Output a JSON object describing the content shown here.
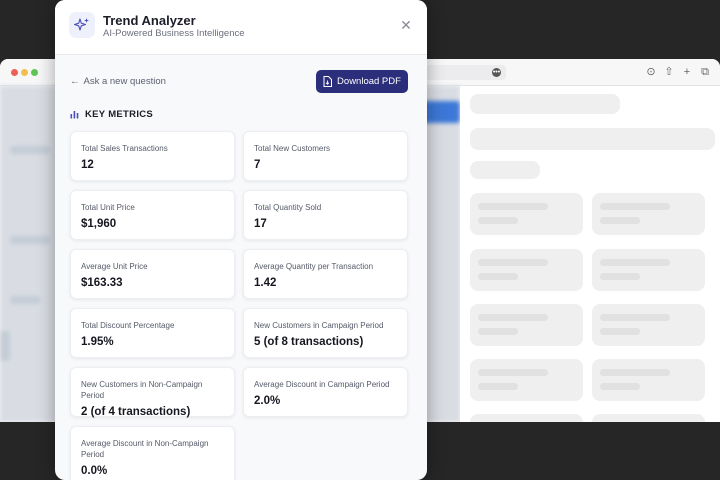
{
  "app": {
    "title": "Trend Analyzer",
    "subtitle": "AI-Powered Business Intelligence",
    "logo_icon": "sparkle-icon",
    "close_icon": "close-icon"
  },
  "actions": {
    "ask_label": "Ask a new question",
    "download_label": "Download PDF",
    "accent": "#2b2e7a"
  },
  "metrics": {
    "heading": "KEY METRICS",
    "items": [
      {
        "label": "Total Sales Transactions",
        "value": "12"
      },
      {
        "label": "Total New Customers",
        "value": "7"
      },
      {
        "label": "Total Unit Price",
        "value": "$1,960"
      },
      {
        "label": "Total Quantity Sold",
        "value": "17"
      },
      {
        "label": "Average Unit Price",
        "value": "$163.33"
      },
      {
        "label": "Average Quantity per Transaction",
        "value": "1.42"
      },
      {
        "label": "Total Discount Percentage",
        "value": "1.95%"
      },
      {
        "label": "New Customers in Campaign Period",
        "value": "5 (of 8 transactions)"
      },
      {
        "label": "New Customers in Non-Campaign Period",
        "value": "2 (of 4 transactions)"
      },
      {
        "label": "Average Discount in Campaign Period",
        "value": "2.0%"
      },
      {
        "label": "Average Discount in Non-Campaign Period",
        "value": "0.0%"
      }
    ]
  }
}
